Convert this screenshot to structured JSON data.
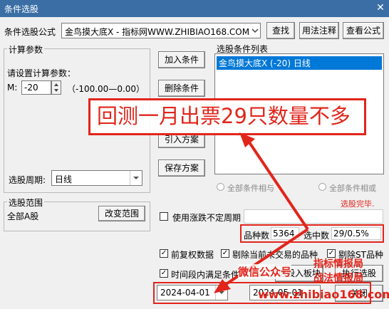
{
  "window": {
    "title": "条件选股",
    "close_glyph": "✕"
  },
  "formula": {
    "label": "条件选股公式",
    "value": "金鸟摸大底X  - 指标网WWW.ZHIBIAO168.COM",
    "buttons": {
      "find": "查找",
      "usage": "用法注释",
      "view": "查看公式"
    }
  },
  "calc": {
    "group_title": "计算参数",
    "prompt": "请设置计算参数：",
    "param_name": "M:",
    "param_value": "-20",
    "param_range": "（-100.00—0.00）",
    "period_label": "选股周期:",
    "period_value": "日线"
  },
  "condition_buttons": {
    "add": "加入条件",
    "delete": "删除条件",
    "import": "引入方案",
    "save": "保存方案"
  },
  "conditions": {
    "title": "选股条件列表",
    "items": [
      "金鸟摸大底X (-20) 日线"
    ],
    "radio_and": "全部条件相与",
    "radio_or": "全部条件相或",
    "status": "选股完毕."
  },
  "scope": {
    "group_title": "选股范围",
    "value": "全部A股",
    "change_button": "改变范围"
  },
  "use_period": {
    "label": "使用涨跌不定周期"
  },
  "stats": {
    "count_label": "品种数",
    "count_value": "5364",
    "selected_label": "选中数",
    "selected_value": "29/0.5%"
  },
  "options": {
    "prev_adjust": "前复权数据",
    "exclude_untraded": "剔除当前未交易的品种",
    "exclude_st": "剔除ST品种",
    "time_range": "时间段内满足条件",
    "to_block": "选股入板块",
    "execute": "执行选股"
  },
  "dates": {
    "start": "2024-04-01",
    "end": "2024-05-01"
  },
  "close_button": "关闭",
  "overlay": {
    "headline": "回测一月出票29只数量不多",
    "wechat": "微信公众号",
    "brand1": "指标情报局",
    "brand2": "战法情报局",
    "url": "www.zhibiao168.com"
  },
  "colors": {
    "accent_red": "#e1251b",
    "selection_blue": "#0078d7",
    "title_blue": "#3a6ea5"
  },
  "icons": {
    "spin": "spin-arrows-icon",
    "dropdown": "chevron-down-icon",
    "check": "checkmark-icon"
  }
}
